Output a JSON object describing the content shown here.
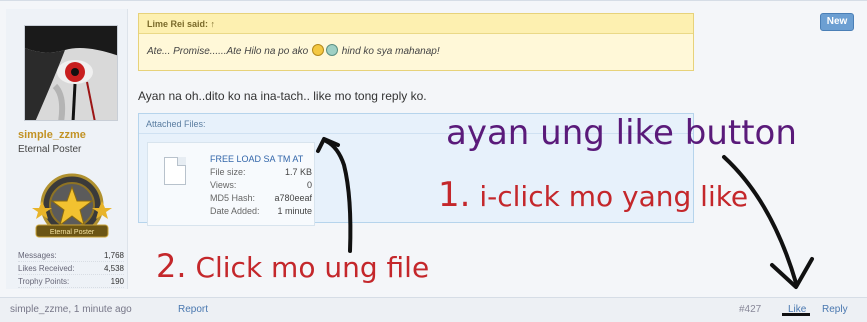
{
  "post": {
    "new_label": "New",
    "user": {
      "name": "simple_zzme",
      "title": "Eternal Poster",
      "badge_text": "Eternal Poster",
      "stats": [
        {
          "label": "Messages:",
          "value": "1,768"
        },
        {
          "label": "Likes Received:",
          "value": "4,538"
        },
        {
          "label": "Trophy Points:",
          "value": "190"
        }
      ]
    },
    "quote": {
      "header": "Lime Rei said: ↑",
      "text_before": "Ate... Promise......Ate Hilo na po ako",
      "text_after": "hind ko sya mahanap!"
    },
    "message": "Ayan na oh..dito ko na ina-tach.. like mo tong reply ko.",
    "attachments": {
      "header": "Attached Files:",
      "file": {
        "name": "FREE LOAD SA TM AT",
        "rows": [
          {
            "label": "File size:",
            "value": "1.7 KB"
          },
          {
            "label": "Views:",
            "value": "0"
          },
          {
            "label": "MD5 Hash:",
            "value": "a780eeaf"
          },
          {
            "label": "Date Added:",
            "value": "1 minute"
          }
        ]
      }
    },
    "footer": {
      "meta": "simple_zzme, 1 minute ago",
      "report": "Report",
      "post_number": "#427",
      "like": "Like",
      "reply": "Reply"
    }
  },
  "annotations": {
    "title": "ayan ung like button",
    "step1_num": "1.",
    "step1_text": "i-click mo yang like",
    "step2_num": "2.",
    "step2_text": "Click mo ung file"
  },
  "colors": {
    "annotation_purple": "#5a1a7a",
    "annotation_red": "#c4272b",
    "link_blue": "#4a78b0",
    "username_gold": "#c29224"
  }
}
